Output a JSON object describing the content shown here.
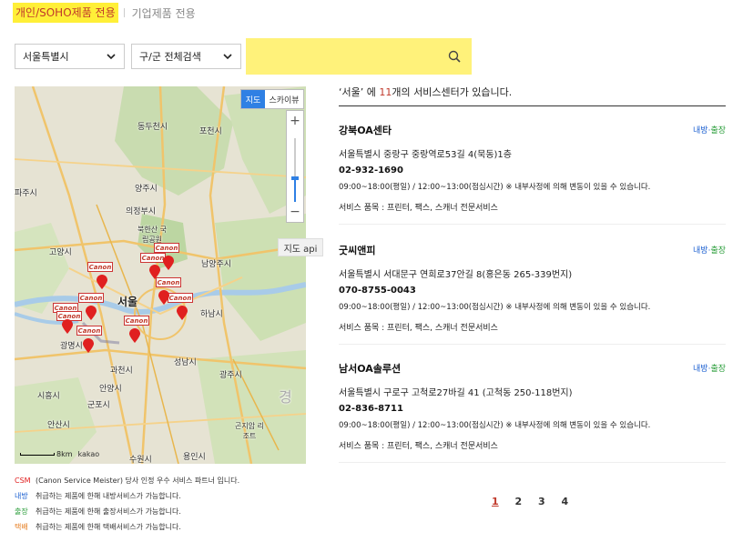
{
  "tabs": {
    "active": "개인/SOHO제품 전용",
    "inactive": "기업제품 전용"
  },
  "filters": {
    "city": "서울특별시",
    "district": "구/군 전체검색",
    "search_placeholder": ""
  },
  "map": {
    "type_map": "지도",
    "type_sky": "스카이뷰",
    "zoom_in": "+",
    "zoom_out": "−",
    "tooltip": "지도 api",
    "scale": "8km",
    "provider": "kakao",
    "marker_label": "Canon",
    "labels": {
      "dongducheon": "동두천시",
      "pocheon": "포천시",
      "yangju": "양주시",
      "paju": "파주시",
      "uijeongbu": "의정부시",
      "goyang": "고양시",
      "namyangju": "남양주시",
      "seoul": "서울",
      "hanam": "하남시",
      "gwangmyeong": "광명시",
      "gwacheon": "과천시",
      "seongnam": "성남시",
      "gwangju": "광주시",
      "siheung": "시흥시",
      "gunpo": "군포시",
      "anyang": "안양시",
      "ansan": "안산시",
      "suwon": "수원시",
      "yongin": "용인시",
      "konjiam": "곤지암 리조트",
      "bukhansan": "북한산 국립공원",
      "gyeong": "경"
    }
  },
  "legend": [
    {
      "key": "CSM",
      "color": "#e02020",
      "text": "(Canon Service Meister) 당사 인정 우수 서비스 파트너 입니다."
    },
    {
      "key": "내방",
      "color": "#1a5fd0",
      "text": "취급하는 제품에 한해 내방서비스가 가능합니다."
    },
    {
      "key": "출장",
      "color": "#2a9d3a",
      "text": "취급하는 제품에 한해 출장서비스가 가능합니다."
    },
    {
      "key": "택배",
      "color": "#e67e22",
      "text": "취급하는 제품에 한해 택배서비스가 가능합니다."
    }
  ],
  "summary": {
    "region": "‘서울’",
    "middle": " 에 ",
    "count": "11",
    "suffix": "개의 서비스센터가 있습니다."
  },
  "centers": [
    {
      "name": "강북OA센타",
      "badge_visit": "내방",
      "badge_sep": "·",
      "badge_trip": "출장",
      "address": "서울특별시 중랑구 중랑역로53길 4(묵동)1층",
      "phone": "02-932-1690",
      "hours": "09:00~18:00(평일) / 12:00~13:00(점심시간) ※ 내부사정에 의해 변동이 있을 수 있습니다.",
      "items": "서비스 품목 : 프린터, 팩스, 스캐너 전문서비스"
    },
    {
      "name": "굿씨앤피",
      "badge_visit": "내방",
      "badge_sep": "·",
      "badge_trip": "출장",
      "address": "서울특별시 서대문구 연희로37안길 8(홍은동 265-339번지)",
      "phone": "070-8755-0043",
      "hours": "09:00~18:00(평일) / 12:00~13:00(점심시간) ※ 내부사정에 의해 변동이 있을 수 있습니다.",
      "items": "서비스 품목 : 프린터, 팩스, 스캐너 전문서비스"
    },
    {
      "name": "남서OA솔루션",
      "badge_visit": "내방",
      "badge_sep": "·",
      "badge_trip": "출장",
      "address": "서울특별시 구로구 고척로27바길 41 (고척동 250-118번지)",
      "phone": "02-836-8711",
      "hours": "09:00~18:00(평일) / 12:00~13:00(점심시간) ※ 내부사정에 의해 변동이 있을 수 있습니다.",
      "items": "서비스 품목 : 프린터, 팩스, 스캐너 전문서비스"
    }
  ],
  "pagination": [
    "1",
    "2",
    "3",
    "4"
  ],
  "colors": {
    "accent_yellow": "#ffef38",
    "accent_red": "#c0392b",
    "visit_blue": "#1a5fd0",
    "trip_green": "#2a9d3a",
    "delivery_orange": "#e67e22",
    "map_blue": "#2f80e4"
  }
}
